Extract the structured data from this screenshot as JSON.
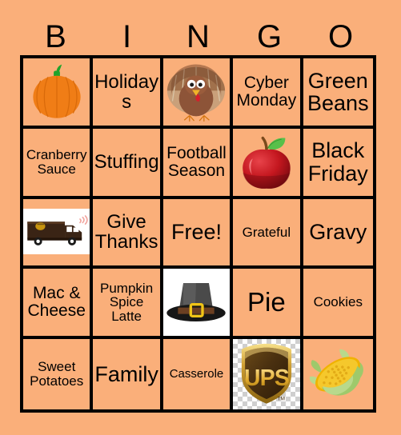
{
  "card": {
    "background_color": "#faaf7a",
    "border_color": "#000000",
    "text_color": "#000000"
  },
  "header": {
    "letters": [
      "B",
      "I",
      "N",
      "G",
      "O"
    ]
  },
  "grid": {
    "columns": 5,
    "rows": 5,
    "cells": [
      {
        "type": "image",
        "icon": "pumpkin-icon",
        "label": "Pumpkin",
        "bg": "card"
      },
      {
        "type": "text",
        "label": "Holidays",
        "size": "fs-lg"
      },
      {
        "type": "image",
        "icon": "turkey-icon",
        "label": "Turkey",
        "bg": "card"
      },
      {
        "type": "text",
        "label": "Cyber Monday",
        "size": "fs-md"
      },
      {
        "type": "text",
        "label": "Green Beans",
        "size": "fs-xl"
      },
      {
        "type": "text",
        "label": "Cranberry Sauce",
        "size": "fs-sm"
      },
      {
        "type": "text",
        "label": "Stuffing",
        "size": "fs-lg"
      },
      {
        "type": "text",
        "label": "Football Season",
        "size": "fs-md"
      },
      {
        "type": "image",
        "icon": "apple-icon",
        "label": "Apple",
        "bg": "card"
      },
      {
        "type": "text",
        "label": "Black Friday",
        "size": "fs-xl"
      },
      {
        "type": "image",
        "icon": "delivery-truck-icon",
        "label": "UPS Delivery Truck",
        "bg": "white-band"
      },
      {
        "type": "text",
        "label": "Give Thanks",
        "size": "fs-lg"
      },
      {
        "type": "text",
        "label": "Free!",
        "size": "fs-xl"
      },
      {
        "type": "text",
        "label": "Grateful",
        "size": "fs-sm"
      },
      {
        "type": "text",
        "label": "Gravy",
        "size": "fs-xl"
      },
      {
        "type": "text",
        "label": "Mac & Cheese",
        "size": "fs-md"
      },
      {
        "type": "text",
        "label": "Pumpkin Spice Latte",
        "size": "fs-sm"
      },
      {
        "type": "image",
        "icon": "pilgrim-hat-icon",
        "label": "Pilgrim Hat",
        "bg": "white"
      },
      {
        "type": "text",
        "label": "Pie",
        "size": "fs-huge"
      },
      {
        "type": "text",
        "label": "Cookies",
        "size": "fs-sm"
      },
      {
        "type": "text",
        "label": "Sweet Potatoes",
        "size": "fs-sm"
      },
      {
        "type": "text",
        "label": "Family",
        "size": "fs-xl"
      },
      {
        "type": "text",
        "label": "Casserole",
        "size": "fs-xs"
      },
      {
        "type": "image",
        "icon": "ups-logo-icon",
        "label": "UPS",
        "bg": "checker"
      },
      {
        "type": "image",
        "icon": "corn-icon",
        "label": "Corn on the Cob",
        "bg": "card"
      }
    ]
  }
}
